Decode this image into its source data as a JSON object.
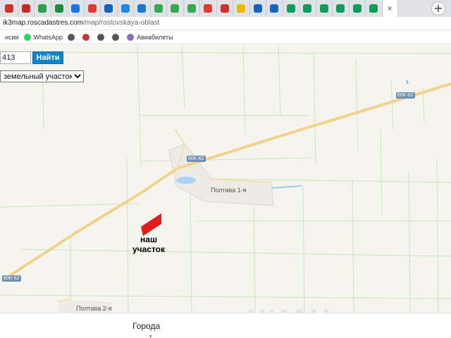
{
  "browser": {
    "tabs": [
      {
        "icon": "red-favicon-icon",
        "color": "#d93025"
      },
      {
        "icon": "red-favicon-icon",
        "color": "#c62828"
      },
      {
        "icon": "green-favicon-icon",
        "color": "#2e9e4f"
      },
      {
        "icon": "green-favicon-icon",
        "color": "#1e8e3e"
      },
      {
        "icon": "blue-favicon-icon",
        "color": "#1a73e8"
      },
      {
        "icon": "yandex-favicon-icon",
        "color": "#e53935"
      },
      {
        "icon": "blue-favicon-icon",
        "color": "#1565c0"
      },
      {
        "icon": "blue-favicon-icon",
        "color": "#1e88e5"
      },
      {
        "icon": "blue-favicon-icon",
        "color": "#1976d2"
      },
      {
        "icon": "green-favicon-icon",
        "color": "#34a853"
      },
      {
        "icon": "green-favicon-icon",
        "color": "#34a853"
      },
      {
        "icon": "green-favicon-icon",
        "color": "#34a853"
      },
      {
        "icon": "yandex-favicon-icon",
        "color": "#e53935"
      },
      {
        "icon": "red-favicon-icon",
        "color": "#d32f2f"
      },
      {
        "icon": "image-favicon-icon",
        "color": "#f4b400"
      },
      {
        "icon": "blue-favicon-icon",
        "color": "#1565c0"
      },
      {
        "icon": "blue-favicon-icon",
        "color": "#1565c0"
      },
      {
        "icon": "dots-favicon-icon",
        "color": "#0f9d58"
      },
      {
        "icon": "dots-favicon-icon",
        "color": "#0f9d58"
      },
      {
        "icon": "dots-favicon-icon",
        "color": "#0f9d58"
      },
      {
        "icon": "dots-favicon-icon",
        "color": "#0f9d58"
      },
      {
        "icon": "dots-favicon-icon",
        "color": "#0f9d58"
      },
      {
        "icon": "dots-favicon-icon",
        "color": "#0f9d58"
      }
    ],
    "active_tab": {
      "icon": "close-icon",
      "text": "×"
    },
    "new_tab": "+",
    "url_host": "ik3map.roscadastres.com",
    "url_path": "/map/rostovskaya-oblast"
  },
  "bookmarks": [
    {
      "label": "нсии",
      "icon": "",
      "color": ""
    },
    {
      "label": "WhatsApp",
      "icon": "whatsapp-icon",
      "color": "#25d366"
    },
    {
      "label": "",
      "icon": "globe-icon",
      "color": "#555555"
    },
    {
      "label": "",
      "icon": "home-icon",
      "color": "#d32f2f"
    },
    {
      "label": "",
      "icon": "globe-icon",
      "color": "#555555"
    },
    {
      "label": "",
      "icon": "globe-icon",
      "color": "#555555"
    },
    {
      "label": "Авиабилеты",
      "icon": "plane-icon",
      "color": "#8e6bbf"
    }
  ],
  "map": {
    "search_value": "413",
    "search_button": "Найти",
    "type_selected": "земельный участок",
    "places": {
      "village1": "Полтава 1-я",
      "village2": "Полтава 2-я"
    },
    "road_badges": {
      "a": "60K-62",
      "b": "60K-62",
      "c": "60K-62"
    },
    "our_plot_line1": "наш",
    "our_plot_line2": "участок",
    "plot_color": "#e21b1b",
    "watermark": "ЦИАН",
    "road_color": "#f3d98a",
    "field_line_color": "#c4e5b4"
  },
  "footer": {
    "cities": "Города",
    "caret": "▼"
  }
}
